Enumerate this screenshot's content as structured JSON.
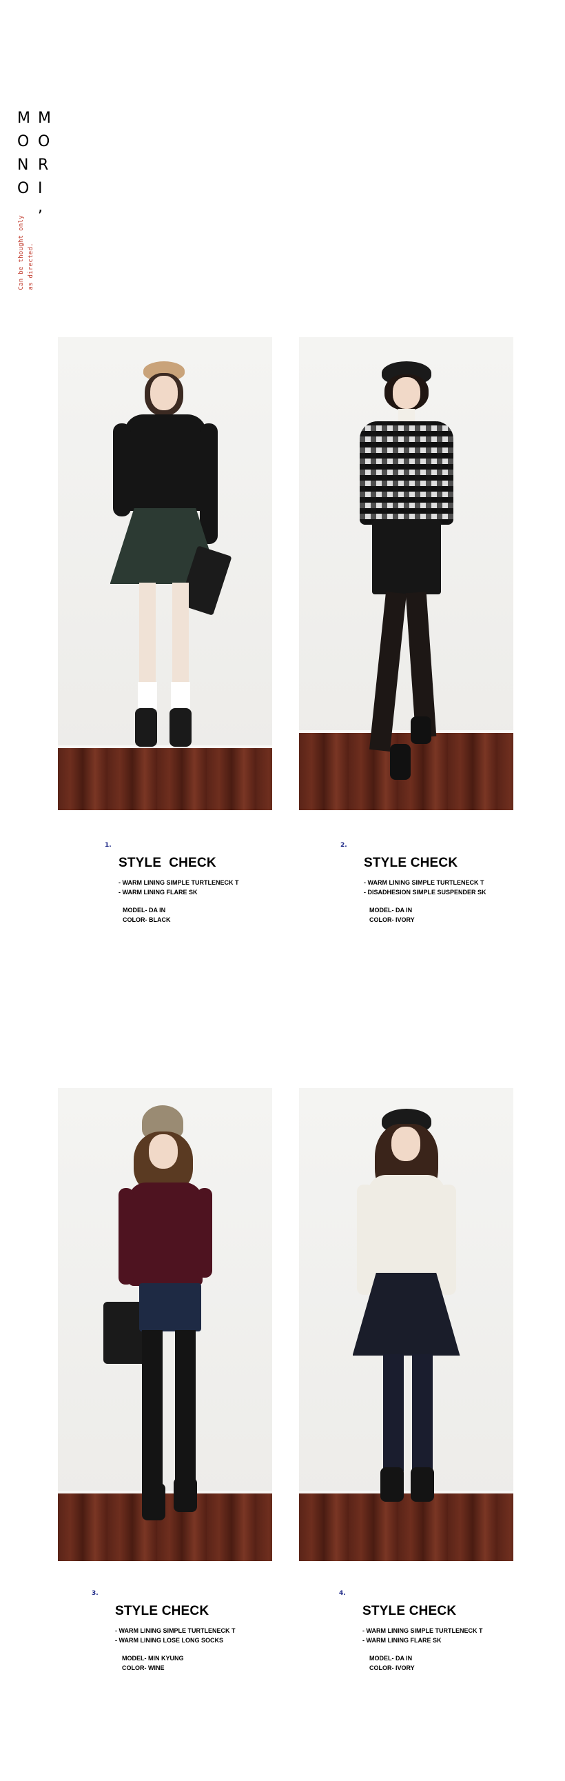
{
  "logo": {
    "rows": [
      [
        "M",
        "M"
      ],
      [
        "O",
        "O"
      ],
      [
        "N",
        "R"
      ],
      [
        "O",
        "I"
      ]
    ],
    "comma": ",",
    "tagline": [
      "Can be thought only",
      "as directed."
    ]
  },
  "looks": [
    {
      "num": "1.",
      "title": "STYLE  CHECK",
      "items": [
        "-  WARM LINING SIMPLE TURTLENECK T",
        "-  WARM LINING FLARE SK"
      ],
      "model": "MODEL- DA IN",
      "color": "COLOR- BLACK",
      "palette": {
        "hat": "#c9a37a",
        "top": "#151515",
        "bottom": "#2c3a33",
        "legs": "#f0e2d6",
        "shoes": "#1a1a1a",
        "bag": "#1b1b1b"
      }
    },
    {
      "num": "2.",
      "title": "STYLE CHECK",
      "items": [
        "-  WARM LINING SIMPLE TURTLENECK T",
        "-  DISADHESION SIMPLE SUSPENDER SK"
      ],
      "model": "MODEL- DA IN",
      "color": "COLOR- IVORY",
      "palette": {
        "hat": "#1a1a1a",
        "top": "#5a5a5a",
        "bottom": "#161616",
        "legs": "#1d1715",
        "shoes": "#111111",
        "bag": "#ffffff"
      }
    },
    {
      "num": "3.",
      "title": "STYLE CHECK",
      "items": [
        "-  WARM LINING SIMPLE TURTLENECK T",
        "-  WARM LINING LOSE LONG SOCKS"
      ],
      "model": "MODEL- MIN KYUNG",
      "color": "COLOR- WINE",
      "palette": {
        "hat": "#9a8b73",
        "top": "#4e1320",
        "bottom": "#1e2a44",
        "legs": "#141414",
        "shoes": "#141414",
        "bag": "#1a1a1a"
      }
    },
    {
      "num": "4.",
      "title": "STYLE CHECK",
      "items": [
        "- WARM LINING SIMPLE TURTLENECK T",
        "- WARM LINING FLARE SK"
      ],
      "model": "MODEL- DA IN",
      "color": "COLOR- IVORY",
      "palette": {
        "hat": "#1a1a1a",
        "top": "#efece4",
        "bottom": "#1a1d2a",
        "legs": "#1a1d2e",
        "shoes": "#141414",
        "bag": "#ffffff"
      }
    }
  ]
}
